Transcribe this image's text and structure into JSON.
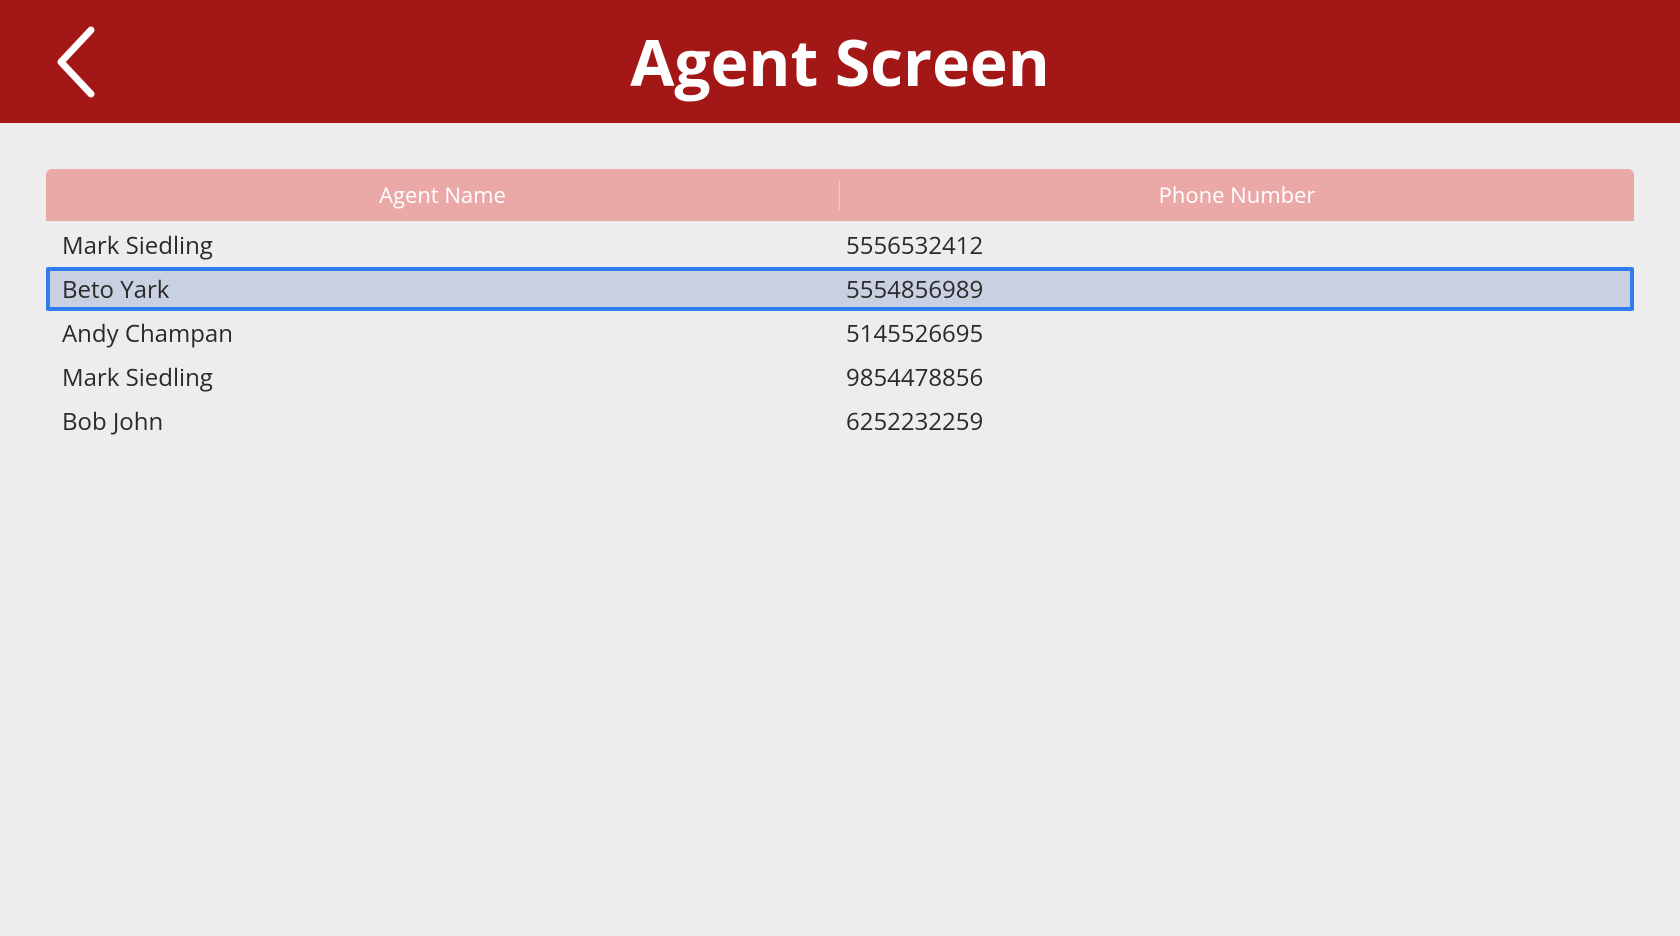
{
  "header": {
    "title": "Agent Screen"
  },
  "table": {
    "columns": {
      "name": "Agent Name",
      "phone": "Phone Number"
    },
    "rows": [
      {
        "name": "Mark Siedling",
        "phone": "5556532412",
        "selected": false
      },
      {
        "name": "Beto Yark",
        "phone": "5554856989",
        "selected": true
      },
      {
        "name": "Andy Champan",
        "phone": "5145526695",
        "selected": false
      },
      {
        "name": "Mark Siedling",
        "phone": "9854478856",
        "selected": false
      },
      {
        "name": "Bob John",
        "phone": "6252232259",
        "selected": false
      }
    ]
  }
}
